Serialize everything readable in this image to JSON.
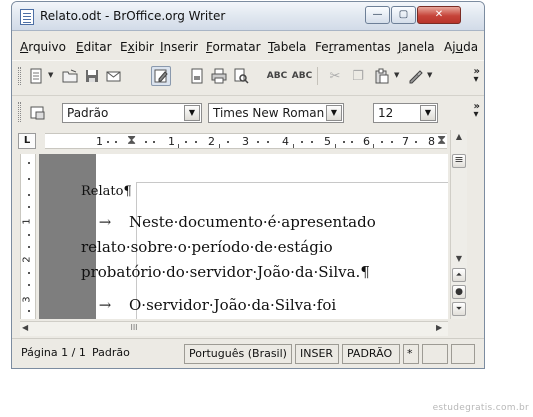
{
  "window": {
    "title": "Relato.odt - BrOffice.org Writer",
    "controls": {
      "minimize": "—",
      "maximize": "▢",
      "close": "✕"
    }
  },
  "menubar": {
    "items": [
      {
        "label": "Arquivo",
        "mnemonic": "A",
        "rest": "rquivo"
      },
      {
        "label": "Editar",
        "mnemonic": "E",
        "rest": "ditar"
      },
      {
        "label": "Exibir",
        "mnemonic": "x",
        "pre": "E",
        "rest": "ibir"
      },
      {
        "label": "Inserir",
        "mnemonic": "I",
        "rest": "nserir"
      },
      {
        "label": "Formatar",
        "mnemonic": "F",
        "rest": "ormatar"
      },
      {
        "label": "Tabela",
        "mnemonic": "T",
        "rest": "abela"
      },
      {
        "label": "Ferramentas",
        "mnemonic": "r",
        "pre": "Fe",
        "rest": "ramentas"
      },
      {
        "label": "Janela",
        "mnemonic": "J",
        "rest": "anela"
      },
      {
        "label": "Ajuda",
        "mnemonic": "u",
        "pre": "Aj",
        "rest": "da"
      }
    ]
  },
  "toolbar": {
    "icons": [
      "new-document-icon",
      "open-icon",
      "save-icon",
      "email-icon",
      "edit-mode-icon",
      "export-pdf-icon",
      "print-icon",
      "page-preview-icon",
      "spellcheck-icon",
      "autospellcheck-icon",
      "cut-icon",
      "copy-icon",
      "paste-icon",
      "clone-format-icon"
    ],
    "overflow": "»"
  },
  "formatting": {
    "style_value": "Padrão",
    "font_value": "Times New Roman",
    "size_value": "12",
    "overflow": "»"
  },
  "ruler": {
    "numbers": [
      "1",
      "1",
      "2",
      "3",
      "4",
      "5",
      "6",
      "7",
      "8"
    ],
    "vertical_numbers": [
      "1",
      "2",
      "3"
    ]
  },
  "document": {
    "paragraphs": [
      {
        "text": "Relato",
        "mark": "¶"
      },
      {
        "lines": [
          "Neste·documento·é·apresentado",
          "relato·sobre·o·período·de·estágio",
          "probatório·do·servidor·João·da·Silva."
        ],
        "mark": "¶",
        "tab": "→"
      },
      {
        "lines": [
          "O·servidor·João·da·Silva·foi"
        ],
        "tab": "→"
      }
    ]
  },
  "scrollbar": {
    "thumb_grip": "III"
  },
  "statusbar": {
    "page": "Página 1 / 1",
    "style": "Padrão",
    "language": "Português (Brasil)",
    "insert_mode": "INSER",
    "selection_mode": "PADRÃO",
    "modified": "*"
  },
  "footer": {
    "watermark": "estudegratis.com.br"
  }
}
